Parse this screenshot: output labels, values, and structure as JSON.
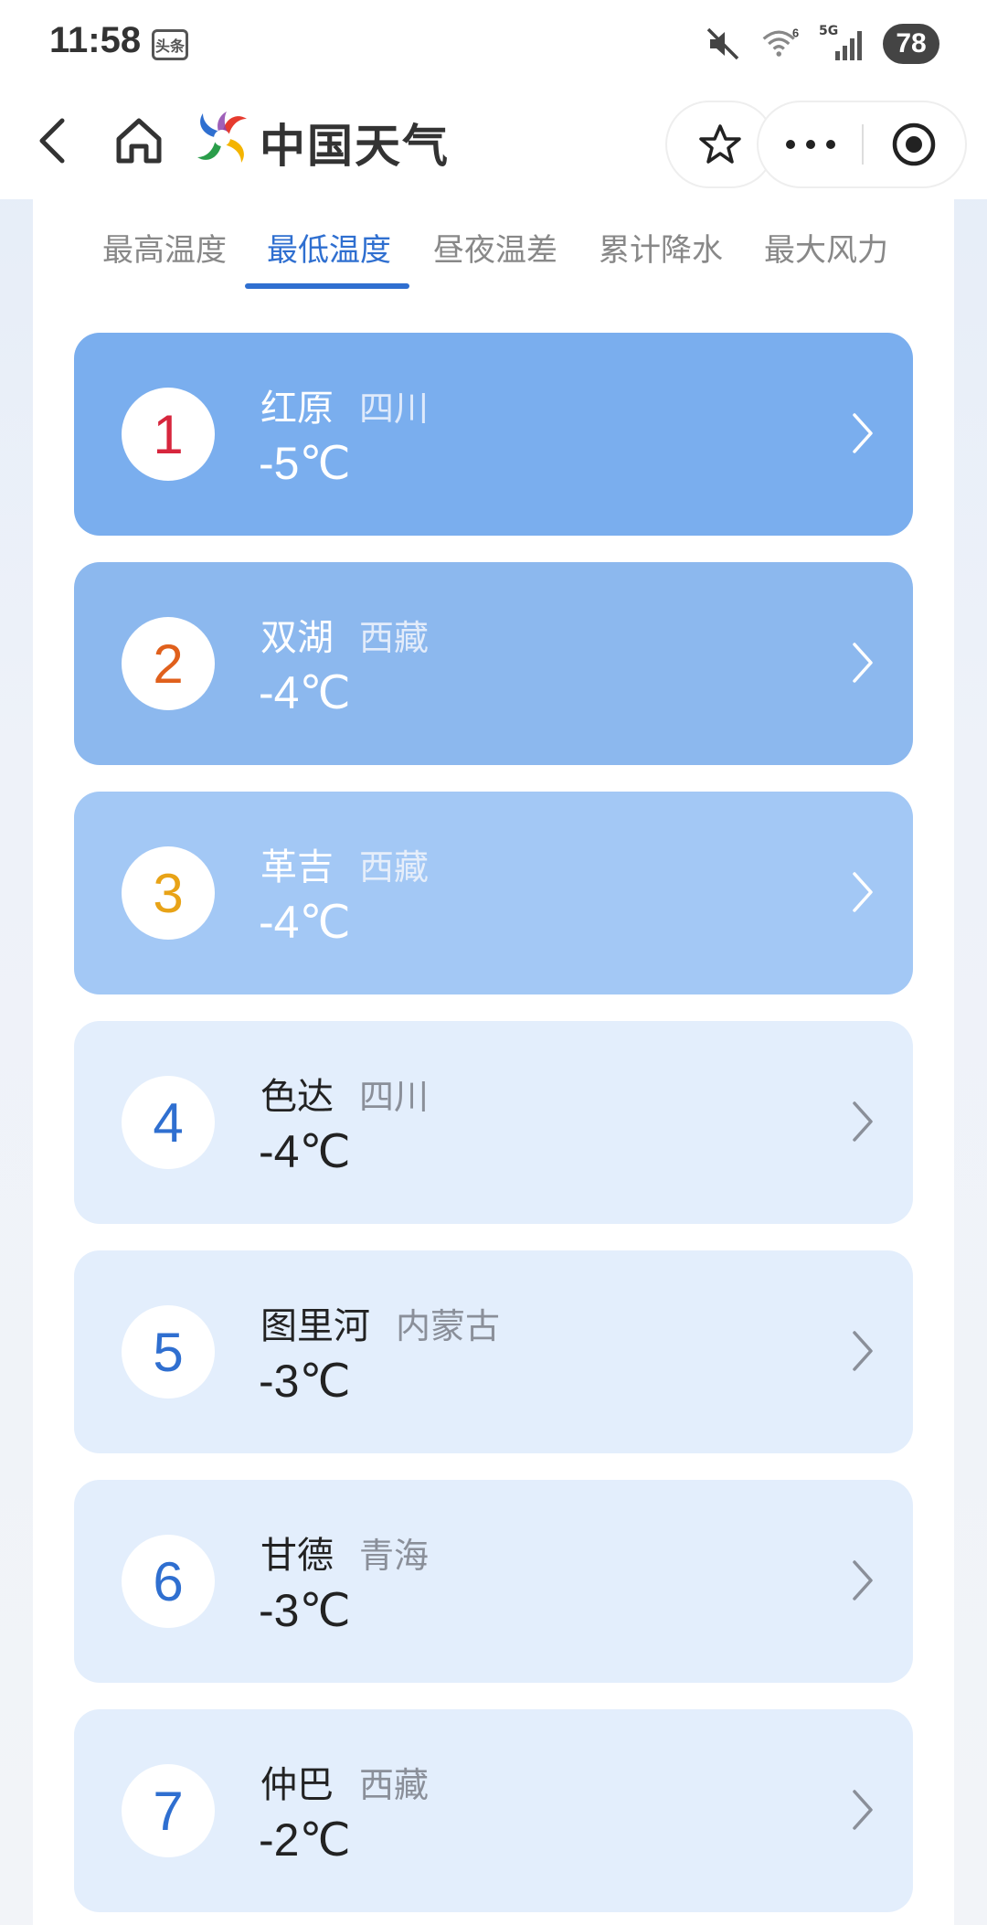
{
  "status_bar": {
    "time": "11:58",
    "app_icon_text": "头条",
    "network_label": "5G",
    "wifi_label": "6",
    "battery": "78"
  },
  "nav": {
    "title": "中国天气"
  },
  "tabs": [
    {
      "label": "最高温度",
      "active": false
    },
    {
      "label": "最低温度",
      "active": true
    },
    {
      "label": "昼夜温差",
      "active": false
    },
    {
      "label": "累计降水",
      "active": false
    },
    {
      "label": "最大风力",
      "active": false
    }
  ],
  "rankings": [
    {
      "rank": "1",
      "station": "红原",
      "province": "四川",
      "temp": "-5℃"
    },
    {
      "rank": "2",
      "station": "双湖",
      "province": "西藏",
      "temp": "-4℃"
    },
    {
      "rank": "3",
      "station": "革吉",
      "province": "西藏",
      "temp": "-4℃"
    },
    {
      "rank": "4",
      "station": "色达",
      "province": "四川",
      "temp": "-4℃"
    },
    {
      "rank": "5",
      "station": "图里河",
      "province": "内蒙古",
      "temp": "-3℃"
    },
    {
      "rank": "6",
      "station": "甘德",
      "province": "青海",
      "temp": "-3℃"
    },
    {
      "rank": "7",
      "station": "仲巴",
      "province": "西藏",
      "temp": "-2℃"
    }
  ],
  "colors": {
    "accent": "#2f6fd0",
    "card_1_bg": "#7aaeee",
    "card_2_bg": "#8cb8ee",
    "card_3_bg": "#a3c8f5",
    "card_other_bg": "#e3eefc",
    "rank_1": "#d7263d",
    "rank_2": "#e0601c",
    "rank_3": "#e8a317",
    "rank_other": "#2f6fd0"
  }
}
